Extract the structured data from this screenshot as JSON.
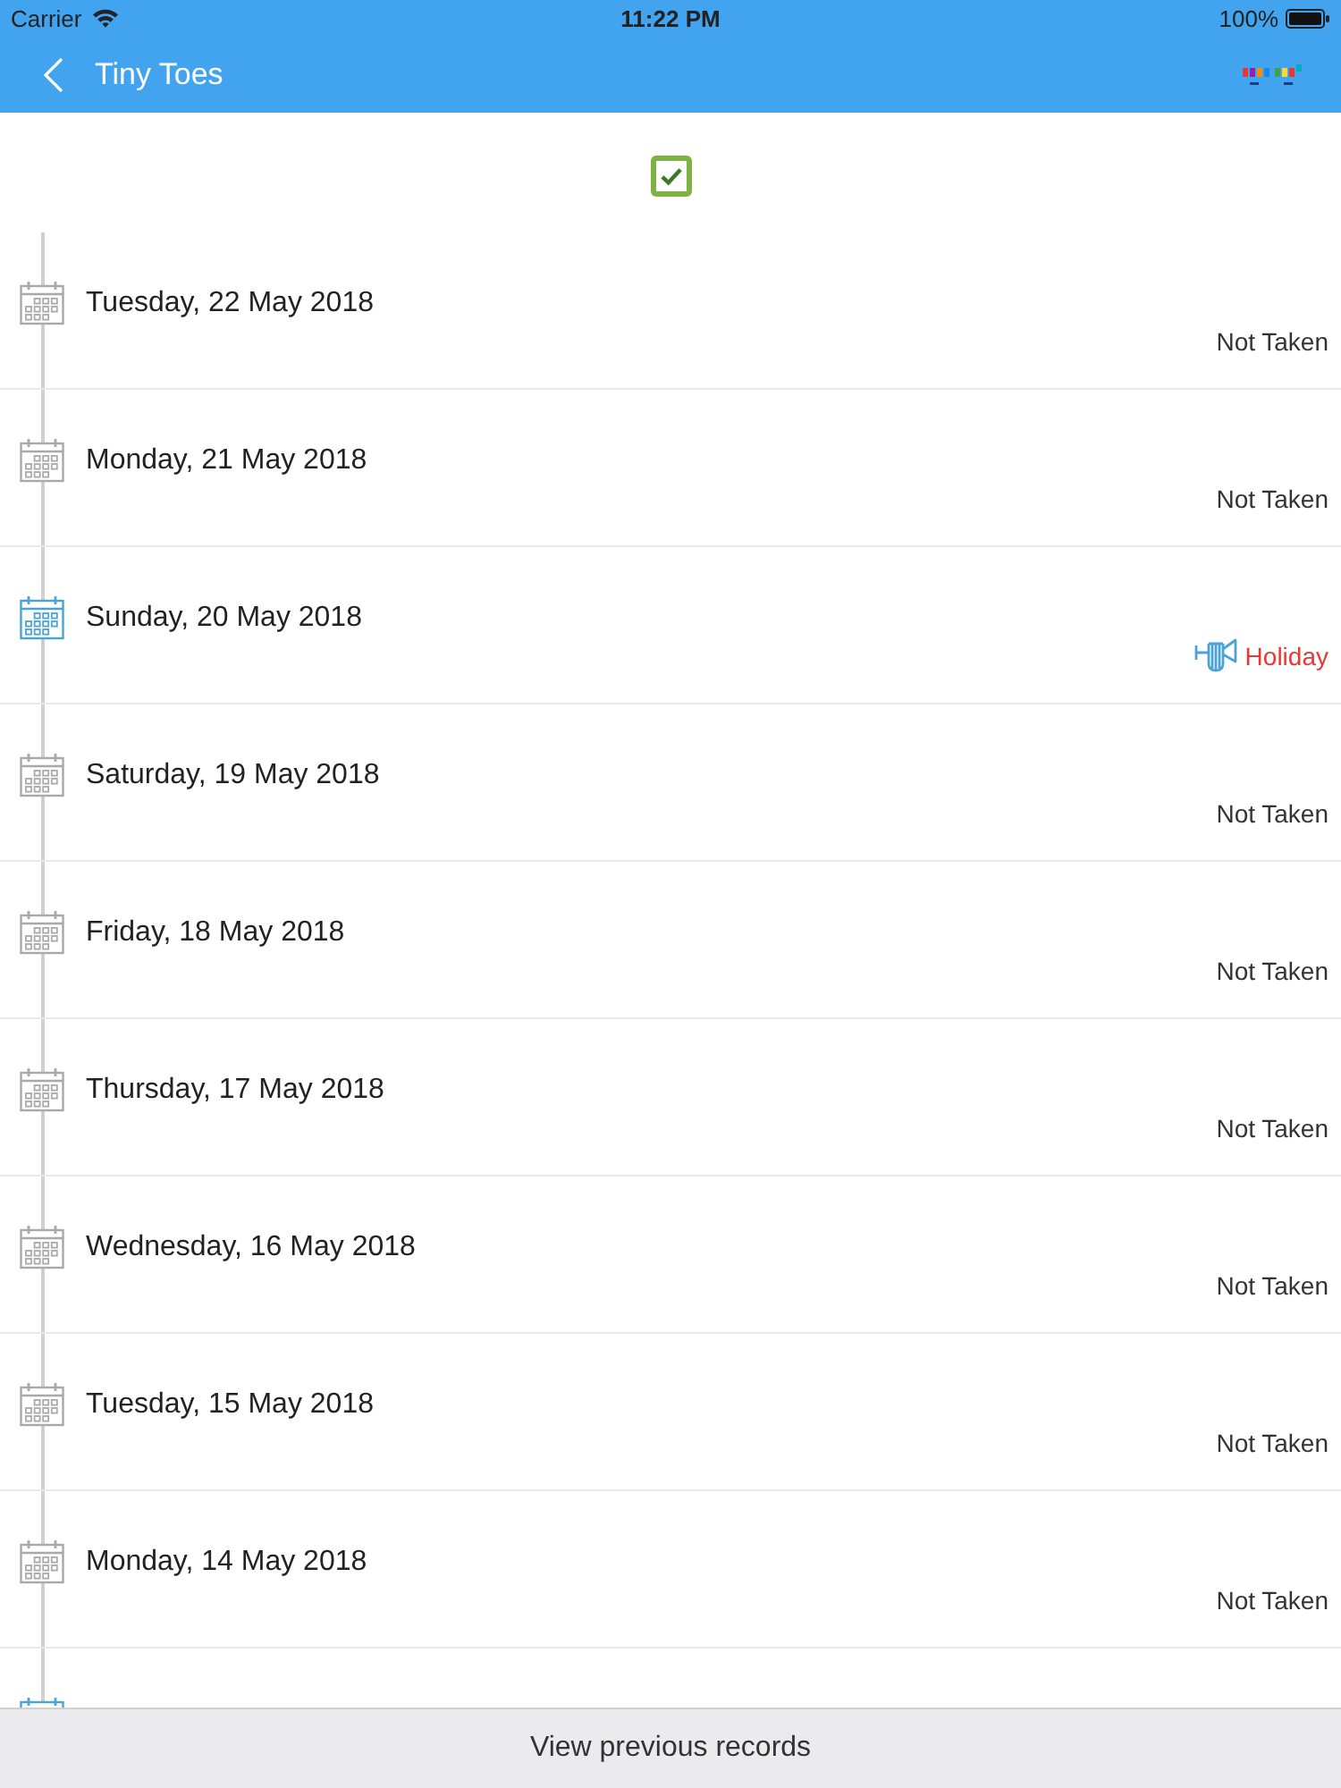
{
  "status_bar": {
    "carrier": "Carrier",
    "time": "11:22 PM",
    "battery": "100%"
  },
  "nav_bar": {
    "title": "Tiny Toes"
  },
  "filter": {
    "checked": true
  },
  "records": [
    {
      "kind": "not_taken",
      "date": "Tuesday, 22 May 2018",
      "status": "Not Taken"
    },
    {
      "kind": "not_taken",
      "date": "Monday, 21 May 2018",
      "status": "Not Taken"
    },
    {
      "kind": "holiday",
      "date": "Sunday, 20 May 2018",
      "status": "Holiday"
    },
    {
      "kind": "not_taken",
      "date": "Saturday, 19 May 2018",
      "status": "Not Taken"
    },
    {
      "kind": "not_taken",
      "date": "Friday, 18 May 2018",
      "status": "Not Taken"
    },
    {
      "kind": "not_taken",
      "date": "Thursday, 17 May 2018",
      "status": "Not Taken"
    },
    {
      "kind": "not_taken",
      "date": "Wednesday, 16 May 2018",
      "status": "Not Taken"
    },
    {
      "kind": "not_taken",
      "date": "Tuesday, 15 May 2018",
      "status": "Not Taken"
    },
    {
      "kind": "not_taken",
      "date": "Monday, 14 May 2018",
      "status": "Not Taken"
    },
    {
      "kind": "holiday"
    }
  ],
  "footer": {
    "button": "View previous records"
  }
}
